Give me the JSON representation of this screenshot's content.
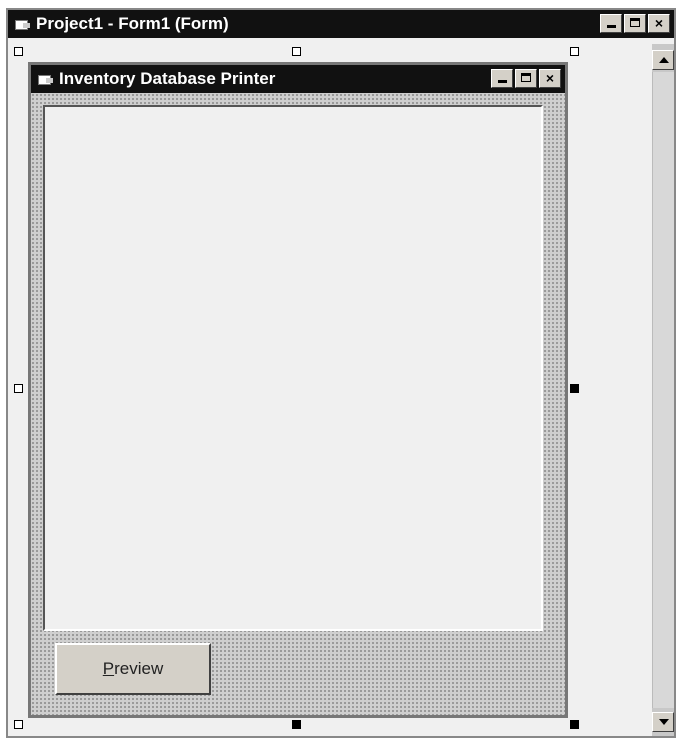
{
  "outer_window": {
    "title": "Project1 - Form1 (Form)",
    "icon": "form-icon",
    "buttons": {
      "minimize": "minimize-icon",
      "maximize": "maximize-icon",
      "close": "×"
    }
  },
  "inner_form": {
    "title": "Inventory Database Printer",
    "icon": "form-icon",
    "buttons": {
      "minimize": "minimize-icon",
      "maximize": "maximize-icon",
      "close": "×"
    },
    "preview_button_label": "Preview"
  },
  "colors": {
    "titlebar": "#111111",
    "window_face": "#d4d0c8",
    "client_bg": "#f0f0f0"
  }
}
